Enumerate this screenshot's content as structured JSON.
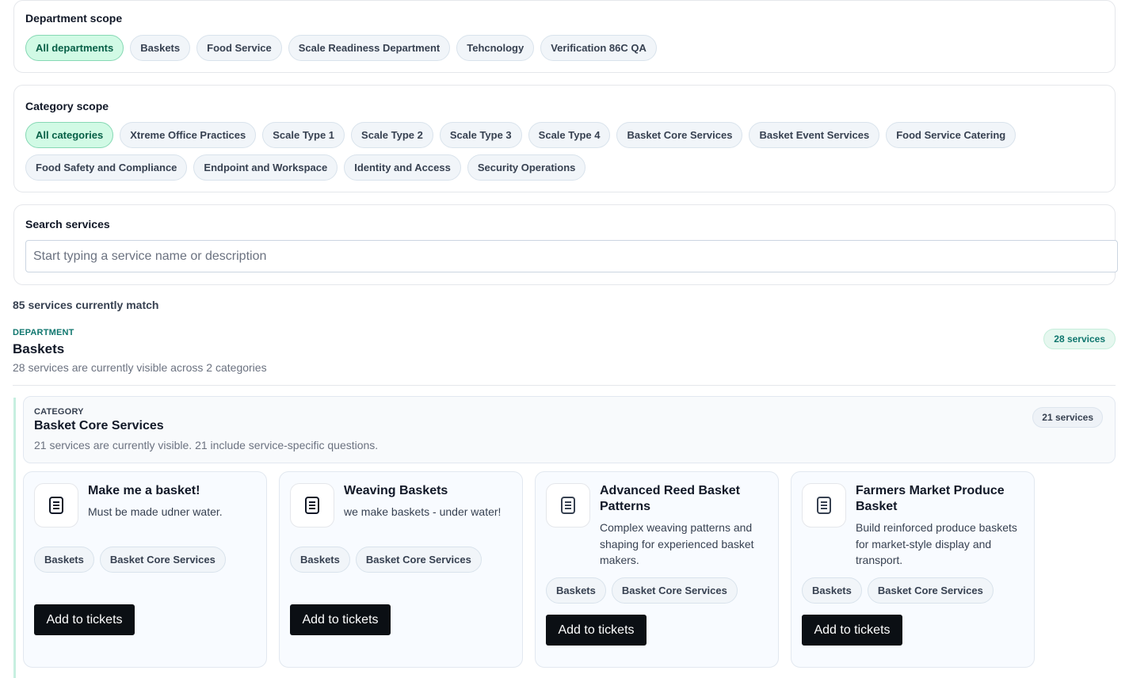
{
  "department_scope": {
    "title": "Department scope",
    "chips": [
      {
        "label": "All departments",
        "active": true
      },
      {
        "label": "Baskets",
        "active": false
      },
      {
        "label": "Food Service",
        "active": false
      },
      {
        "label": "Scale Readiness Department",
        "active": false
      },
      {
        "label": "Tehcnology",
        "active": false
      },
      {
        "label": "Verification 86C QA",
        "active": false
      }
    ]
  },
  "category_scope": {
    "title": "Category scope",
    "chips": [
      {
        "label": "All categories",
        "active": true
      },
      {
        "label": "Xtreme Office Practices",
        "active": false
      },
      {
        "label": "Scale Type 1",
        "active": false
      },
      {
        "label": "Scale Type 2",
        "active": false
      },
      {
        "label": "Scale Type 3",
        "active": false
      },
      {
        "label": "Scale Type 4",
        "active": false
      },
      {
        "label": "Basket Core Services",
        "active": false
      },
      {
        "label": "Basket Event Services",
        "active": false
      },
      {
        "label": "Food Service Catering",
        "active": false
      },
      {
        "label": "Food Safety and Compliance",
        "active": false
      },
      {
        "label": "Endpoint and Workspace",
        "active": false
      },
      {
        "label": "Identity and Access",
        "active": false
      },
      {
        "label": "Security Operations",
        "active": false
      }
    ]
  },
  "search": {
    "title": "Search services",
    "placeholder": "Start typing a service name or description",
    "value": ""
  },
  "results": {
    "match_count": "85 services currently match"
  },
  "department": {
    "kicker": "DEPARTMENT",
    "name": "Baskets",
    "subtitle": "28 services are currently visible across 2 categories",
    "badge": "28 services"
  },
  "category": {
    "kicker": "CATEGORY",
    "name": "Basket Core Services",
    "subtitle": "21 services are currently visible. 21 include service-specific questions.",
    "badge": "21 services"
  },
  "services": [
    {
      "title": "Make me a basket!",
      "description": "Must be made udner water.",
      "tags": [
        "Baskets",
        "Basket Core Services"
      ],
      "button": "Add to tickets",
      "icon": "document-icon"
    },
    {
      "title": "Weaving Baskets",
      "description": "we make baskets - under water!",
      "tags": [
        "Baskets",
        "Basket Core Services"
      ],
      "button": "Add to tickets",
      "icon": "document-icon"
    },
    {
      "title": "Advanced Reed Basket Patterns",
      "description": "Complex weaving patterns and shaping for experienced basket makers.",
      "tags": [
        "Baskets",
        "Basket Core Services"
      ],
      "button": "Add to tickets",
      "icon": "document-icon"
    },
    {
      "title": "Farmers Market Produce Basket",
      "description": "Build reinforced produce baskets for market-style display and transport.",
      "tags": [
        "Baskets",
        "Basket Core Services"
      ],
      "button": "Add to tickets",
      "icon": "document-icon"
    }
  ]
}
